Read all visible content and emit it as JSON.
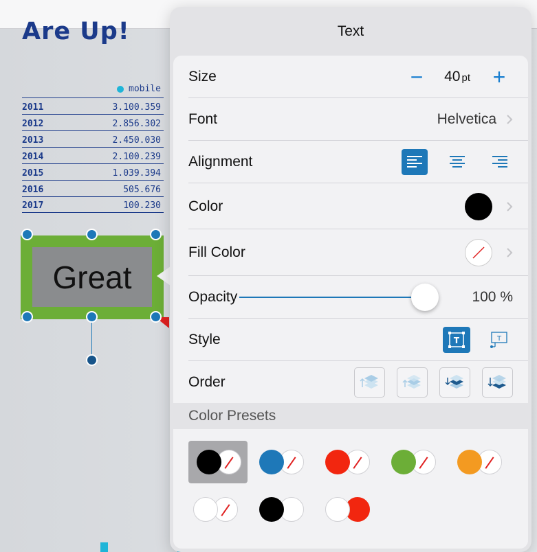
{
  "document": {
    "title": "Are Up!",
    "legend_label": "mobile",
    "rows": [
      {
        "year": "2011",
        "value": "3.100.359"
      },
      {
        "year": "2012",
        "value": "2.856.302"
      },
      {
        "year": "2013",
        "value": "2.450.030"
      },
      {
        "year": "2014",
        "value": "2.100.239"
      },
      {
        "year": "2015",
        "value": "1.039.394"
      },
      {
        "year": "2016",
        "value": "505.676"
      },
      {
        "year": "2017",
        "value": "100.230"
      }
    ],
    "selected_text": "Great"
  },
  "popover": {
    "title": "Text",
    "size": {
      "label": "Size",
      "value": "40",
      "unit": "pt",
      "decrement": "−",
      "increment": "+"
    },
    "font": {
      "label": "Font",
      "value": "Helvetica"
    },
    "alignment": {
      "label": "Alignment",
      "selected": "left",
      "options": [
        "left",
        "center",
        "right"
      ]
    },
    "color": {
      "label": "Color",
      "value": "#000000"
    },
    "fill_color": {
      "label": "Fill Color",
      "value": "none"
    },
    "opacity": {
      "label": "Opacity",
      "value": "100 %",
      "level": 1.0
    },
    "style": {
      "label": "Style",
      "selected": "text-box"
    },
    "order": {
      "label": "Order"
    },
    "presets": {
      "label": "Color Presets",
      "items": [
        {
          "text": "#000000",
          "fill": "none",
          "selected": true
        },
        {
          "text": "#1e78b8",
          "fill": "none"
        },
        {
          "text": "#f2260f",
          "fill": "none"
        },
        {
          "text": "#6cae37",
          "fill": "none"
        },
        {
          "text": "#f39a21",
          "fill": "none"
        },
        {
          "text": "#ffffff",
          "fill": "none"
        },
        {
          "text": "#000000",
          "fill": "#ffffff"
        },
        {
          "text": "#ffffff",
          "fill": "#f2260f"
        }
      ]
    }
  },
  "colors": {
    "accent": "#1e78b8",
    "doc_text": "#1b3a8a",
    "selection_green": "#6cae37"
  }
}
